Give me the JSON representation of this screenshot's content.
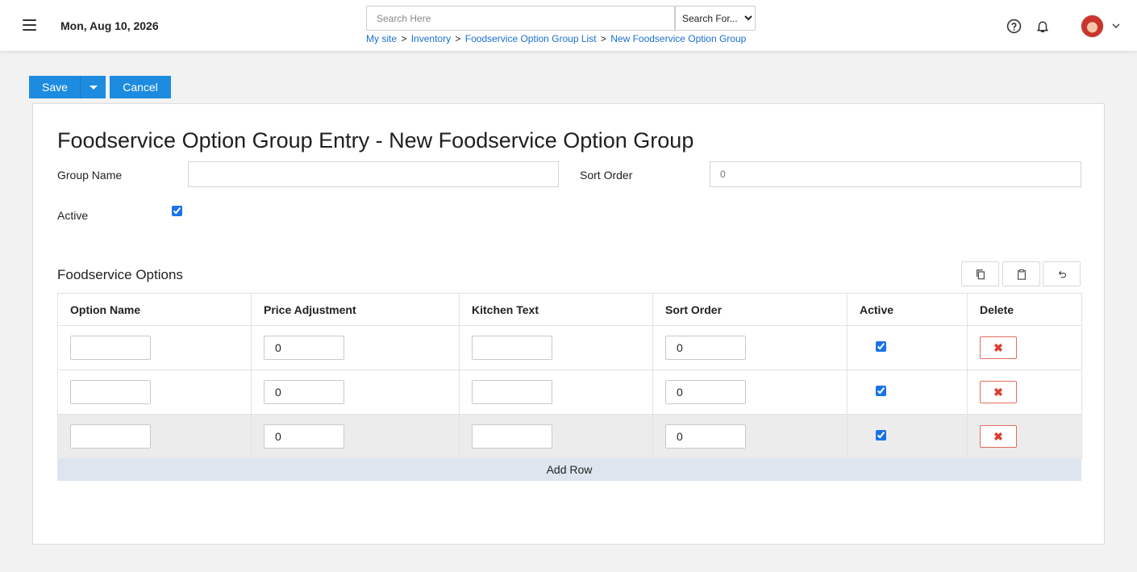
{
  "header": {
    "date": "Mon, Aug 10, 2026",
    "search_placeholder": "Search Here",
    "search_for_selected": "Search For...",
    "breadcrumb": [
      "My site",
      "Inventory",
      "Foodservice Option Group List",
      "New Foodservice Option Group"
    ],
    "breadcrumb_sep": ">"
  },
  "toolbar": {
    "save_label": "Save",
    "cancel_label": "Cancel"
  },
  "form": {
    "title": "Foodservice Option Group Entry - New Foodservice Option Group",
    "group_name_label": "Group Name",
    "group_name_value": "",
    "sort_order_label": "Sort Order",
    "sort_order_placeholder": "0",
    "active_label": "Active",
    "active_checked": true
  },
  "options": {
    "section_title": "Foodservice Options",
    "actions": [
      "copy-icon",
      "paste-icon",
      "undo-icon"
    ],
    "columns": [
      "Option Name",
      "Price Adjustment",
      "Kitchen Text",
      "Sort Order",
      "Active",
      "Delete"
    ],
    "rows": [
      {
        "option_name": "",
        "price_adjustment": "0",
        "kitchen_text": "",
        "sort_order": "0",
        "active": true
      },
      {
        "option_name": "",
        "price_adjustment": "0",
        "kitchen_text": "",
        "sort_order": "0",
        "active": true
      },
      {
        "option_name": "",
        "price_adjustment": "0",
        "kitchen_text": "",
        "sort_order": "0",
        "active": true
      }
    ],
    "add_row_label": "Add Row"
  },
  "colors": {
    "accent": "#1d8ce0",
    "link": "#1a6fd0",
    "delete": "#d9402f",
    "add_row_bg": "#dde6ef"
  }
}
